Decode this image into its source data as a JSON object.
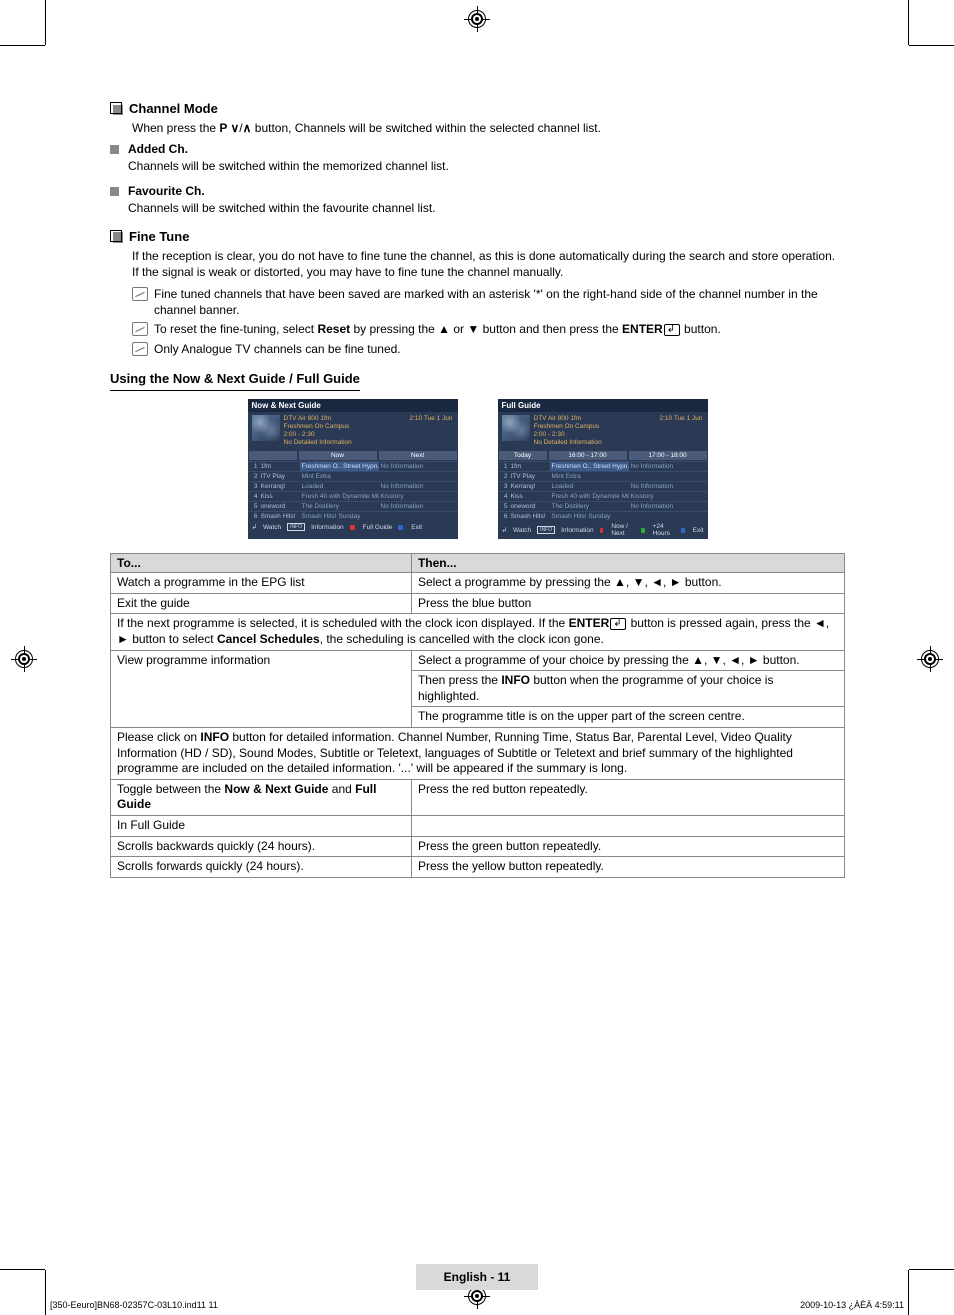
{
  "sections": {
    "channel_mode": {
      "title": "Channel Mode",
      "desc_pre": "When press the ",
      "desc_mid": "P ",
      "desc_post": " button, Channels will be switched within the selected channel list.",
      "added": {
        "title": "Added Ch.",
        "desc": "Channels will be switched within the memorized channel list."
      },
      "fav": {
        "title": "Favourite Ch.",
        "desc": "Channels will be switched within the favourite channel list."
      }
    },
    "fine_tune": {
      "title": "Fine Tune",
      "para": "If the reception is clear, you do not have to fine tune the channel, as this is done automatically during the search and store operation. If the signal is weak or distorted, you may have to fine tune the channel manually.",
      "n1": "Fine tuned channels that have been saved are marked with an asterisk '*' on the right-hand side of the channel number in the channel banner.",
      "n2_a": "To reset the fine-tuning, select ",
      "n2_b": "Reset",
      "n2_c": " by pressing the ▲ or ▼ button and then press the ",
      "n2_d": "ENTER",
      "n2_e": " button.",
      "n3": "Only Analogue TV channels can be fine tuned."
    },
    "guide_heading": "Using the Now & Next Guide / Full Guide"
  },
  "guide_panels": {
    "now_next": {
      "title": "Now & Next Guide",
      "prog_title": "DTV Air 800 1fm",
      "prog_sub": "Freshmen On Campus",
      "prog_time": "2:00 - 2:30",
      "prog_info": "No Detailed Information",
      "clock": "2:10  Tue 1 Jun",
      "col1": "Now",
      "col2": "Next",
      "rows": [
        {
          "n": "1",
          "ch": "1fm",
          "c1": "Freshmen O..  Street Hypn..",
          "c2": "No Information",
          "sel": true
        },
        {
          "n": "2",
          "ch": "ITV Play",
          "c1": "Mint Extra",
          "c2": ""
        },
        {
          "n": "3",
          "ch": "Kerrang!",
          "c1": "Loaded",
          "c2": "No Information"
        },
        {
          "n": "4",
          "ch": "Kiss",
          "c1": "Fresh 40 with Dynamite MC",
          "c2": "Kisstory"
        },
        {
          "n": "5",
          "ch": "oneword",
          "c1": "The Distillery",
          "c2": "No Information"
        },
        {
          "n": "6",
          "ch": "Smash Hits!",
          "c1": "Smash Hits! Sunday",
          "c2": ""
        }
      ],
      "foot": [
        "Watch",
        "Information",
        "Full Guide",
        "Exit"
      ]
    },
    "full": {
      "title": "Full Guide",
      "prog_title": "DTV Air 800 1fm",
      "prog_sub": "Freshmen On Campus",
      "prog_time": "2:00 - 2:30",
      "prog_info": "No Detailed Information",
      "clock": "2:10  Tue 1 Jun",
      "col0": "Today",
      "col1": "16:00 - 17:00",
      "col2": "17:00 - 18:00",
      "rows": [
        {
          "n": "1",
          "ch": "1fm",
          "c1": "Freshmen O..  Street Hypn..",
          "c2": "No Information",
          "sel": true
        },
        {
          "n": "2",
          "ch": "ITV Play",
          "c1": "Mint Extra",
          "c2": ""
        },
        {
          "n": "3",
          "ch": "Kerrang!",
          "c1": "Loaded",
          "c2": "No Information"
        },
        {
          "n": "4",
          "ch": "Kiss",
          "c1": "Fresh 40 with Dynamite MC",
          "c2": "Kisstory"
        },
        {
          "n": "5",
          "ch": "oneword",
          "c1": "The Distillery",
          "c2": "No Information"
        },
        {
          "n": "6",
          "ch": "Smash Hits!",
          "c1": "Smash Hits! Sunday",
          "c2": ""
        }
      ],
      "foot": [
        "Watch",
        "Information",
        "Now / Next",
        "+24 Hours",
        "Exit"
      ]
    }
  },
  "table": {
    "h1": "To...",
    "h2": "Then...",
    "r1a": "Watch a programme in the EPG list",
    "r1b": "Select a programme by pressing the ▲, ▼, ◄, ► button.",
    "r2a": "Exit the guide",
    "r2b": "Press the blue button",
    "note1a": "If the next programme is selected, it is scheduled with the clock icon displayed. If the ",
    "note1b": "ENTER",
    "note1c": " button is pressed again, press the ◄, ► button to select ",
    "note1d": "Cancel Schedules",
    "note1e": ", the scheduling is cancelled with the clock icon gone.",
    "r3a": "View programme information",
    "r3b1": "Select a programme of your choice by pressing the ▲, ▼, ◄, ► button.",
    "r3b2a": "Then press the ",
    "r3b2b": "INFO",
    "r3b2c": " button when the programme of your choice is highlighted.",
    "r3b3": "The programme title is on the upper part of the screen centre.",
    "note2a": "Please click on ",
    "note2b": "INFO",
    "note2c": " button for detailed information. Channel Number, Running Time, Status Bar, Parental Level, Video Quality Information (HD / SD), Sound Modes, Subtitle or Teletext, languages of Subtitle or Teletext and brief summary of the highlighted programme are included on the detailed information. '...' will be appeared if the summary is long.",
    "r4a1": "Toggle between the ",
    "r4a2": "Now & Next Guide",
    "r4a3": " and ",
    "r4a4": "Full Guide",
    "r4b": "Press the red button repeatedly.",
    "r5a": "In Full Guide",
    "r6a": "Scrolls backwards quickly (24 hours).",
    "r6b": "Press the green button repeatedly.",
    "r7a": "Scrolls forwards quickly (24 hours).",
    "r7b": "Press the yellow button repeatedly."
  },
  "footer": {
    "label": "English - 11",
    "left": "[350-Eeuro]BN68-02357C-03L10.ind11   11",
    "right": "2009-10-13   ¿ÀÈÄ 4:59:11"
  }
}
